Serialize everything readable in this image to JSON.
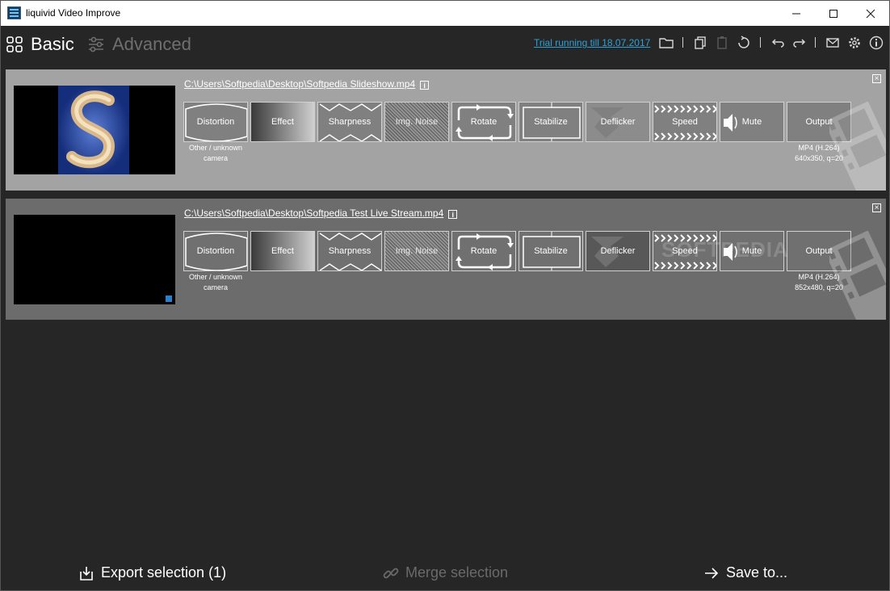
{
  "window": {
    "title": "liquivid Video Improve"
  },
  "toolbar": {
    "mode_basic": "Basic",
    "mode_advanced": "Advanced",
    "trial_text": "Trial running till 18.07.2017"
  },
  "files": [
    {
      "path": "C:\\Users\\Softpedia\\Desktop\\Softpedia Slideshow.mp4",
      "tiles": [
        "Distortion",
        "Effect",
        "Sharpness",
        "Img. Noise",
        "Rotate",
        "Stabilize",
        "Deflicker",
        "Speed",
        "Mute",
        "Output"
      ],
      "distortion_sub1": "Other / unknown",
      "distortion_sub2": "camera",
      "output_sub1": "MP4 (H.264)",
      "output_sub2": "640x350, q=20"
    },
    {
      "path": "C:\\Users\\Softpedia\\Desktop\\Softpedia Test Live Stream.mp4",
      "tiles": [
        "Distortion",
        "Effect",
        "Sharpness",
        "Img. Noise",
        "Rotate",
        "Stabilize",
        "Deflicker",
        "Speed",
        "Mute",
        "Output"
      ],
      "distortion_sub1": "Other / unknown",
      "distortion_sub2": "camera",
      "output_sub1": "MP4 (H.264)",
      "output_sub2": "852x480, q=20",
      "watermark": "SOFTPEDIA"
    }
  ],
  "bottom": {
    "export_label": "Export selection (1)",
    "merge_label": "Merge selection",
    "save_label": "Save to..."
  },
  "colors": {
    "accent_link": "#2aa3dc",
    "row_selected": "#a3a3a3",
    "row_normal": "#6c6c6c"
  }
}
